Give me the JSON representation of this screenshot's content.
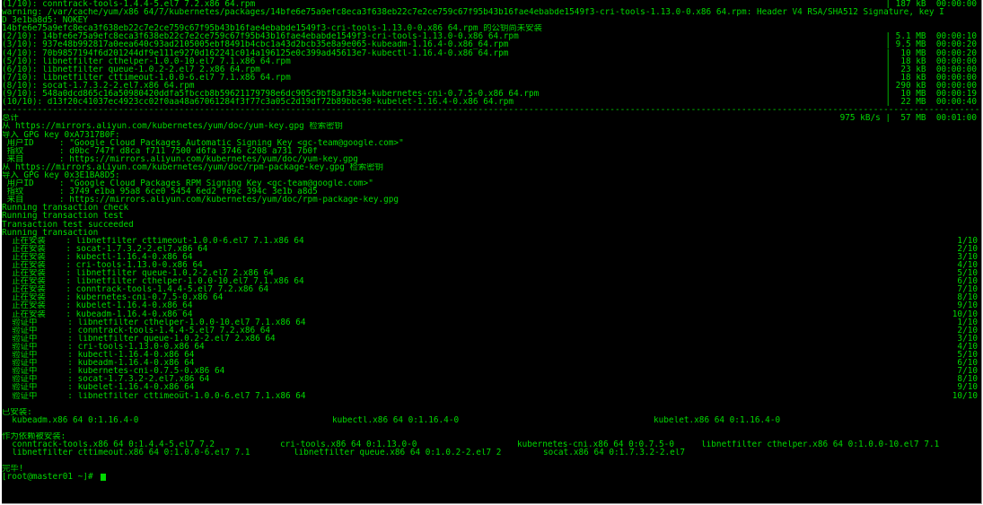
{
  "terminal": {
    "lines": [
      {
        "left": "(1/10): conntrack-tools-1.4.4-5.el7_7.2.x86_64.rpm",
        "mid": "| 187 kB  00:00:00"
      },
      {
        "left": "warning: /var/cache/yum/x86_64/7/kubernetes/packages/14bfe6e75a9efc8eca3f638eb22c7e2ce759c67f95b43b16fae4ebabde1549f3-cri-tools-1.13.0-0.x86_64.rpm: Header V4 RSA/SHA512 Signature, key I"
      },
      {
        "left": "D 3e1ba8d5: NOKEY"
      },
      {
        "left": "14bfe6e75a9efc8eca3f638eb22c7e2ce759c67f95b43b16fae4ebabde1549f3-cri-tools-1.13.0-0.x86_64.rpm 的公钥尚未安装"
      },
      {
        "left": "(2/10): 14bfe6e75a9efc8eca3f638eb22c7e2ce759c67f95b43b16fae4ebabde1549f3-cri-tools-1.13.0-0.x86_64.rpm",
        "mid": "| 5.1 MB  00:00:10"
      },
      {
        "left": "(3/10): 937e48b992817a0eea640c93ad2105005ebf8491b4cbc1a43d2bcb35e8a9e065-kubeadm-1.16.4-0.x86_64.rpm",
        "mid": "| 9.5 MB  00:00:20"
      },
      {
        "left": "(4/10): 70b9857194f6d201244df9e111e9270d162241c014a196125e0c399ad45613e7-kubectl-1.16.4-0.x86_64.rpm",
        "mid": "|  10 MB  00:00:20"
      },
      {
        "left": "(5/10): libnetfilter_cthelper-1.0.0-10.el7_7.1.x86_64.rpm",
        "mid": "|  18 kB  00:00:00"
      },
      {
        "left": "(6/10): libnetfilter_queue-1.0.2-2.el7_2.x86_64.rpm",
        "mid": "|  23 kB  00:00:00"
      },
      {
        "left": "(7/10): libnetfilter_cttimeout-1.0.0-6.el7_7.1.x86_64.rpm",
        "mid": "|  18 kB  00:00:00"
      },
      {
        "left": "(8/10): socat-1.7.3.2-2.el7.x86_64.rpm",
        "mid": "| 290 kB  00:00:00"
      },
      {
        "left": "(9/10): 548a0dcd865c16a50980420ddfa5fbccb8b59621179798e6dc905c9bf8af3b34-kubernetes-cni-0.7.5-0.x86_64.rpm",
        "mid": "|  10 MB  00:00:19"
      },
      {
        "left": "(10/10): d13f20c41037ec4923cc02f0aa48a67061284f3f77c3a05c2d19df72b89bbc98-kubelet-1.16.4-0.x86_64.rpm",
        "mid": "|  22 MB  00:00:40"
      },
      {
        "left": "-------------------------------------------------------------------------------------------------------------------------------------------------------------------------------------------------------------------"
      },
      {
        "left": "总计",
        "mid": "975 kB/s |  57 MB  00:01:00"
      },
      {
        "left": "从 https://mirrors.aliyun.com/kubernetes/yum/doc/yum-key.gpg 检索密钥"
      },
      {
        "left": "导入 GPG key 0xA7317B0F:"
      },
      {
        "left": " 用户ID     : \"Google Cloud Packages Automatic Signing Key <gc-team@google.com>\""
      },
      {
        "left": " 指纹       : d0bc 747f d8ca f711 7500 d6fa 3746 c208 a731 7b0f"
      },
      {
        "left": " 来自       : https://mirrors.aliyun.com/kubernetes/yum/doc/yum-key.gpg"
      },
      {
        "left": "从 https://mirrors.aliyun.com/kubernetes/yum/doc/rpm-package-key.gpg 检索密钥"
      },
      {
        "left": "导入 GPG key 0x3E1BA8D5:"
      },
      {
        "left": " 用户ID     : \"Google Cloud Packages RPM Signing Key <gc-team@google.com>\""
      },
      {
        "left": " 指纹       : 3749 e1ba 95a8 6ce0 5454 6ed2 f09c 394c 3e1b a8d5"
      },
      {
        "left": " 来自       : https://mirrors.aliyun.com/kubernetes/yum/doc/rpm-package-key.gpg"
      },
      {
        "left": "Running transaction check"
      },
      {
        "left": "Running transaction test"
      },
      {
        "left": "Transaction test succeeded"
      },
      {
        "left": "Running transaction"
      },
      {
        "left": "  正在安装    : libnetfilter_cttimeout-1.0.0-6.el7_7.1.x86_64",
        "right": "1/10"
      },
      {
        "left": "  正在安装    : socat-1.7.3.2-2.el7.x86_64",
        "right": "2/10"
      },
      {
        "left": "  正在安装    : kubectl-1.16.4-0.x86_64",
        "right": "3/10"
      },
      {
        "left": "  正在安装    : cri-tools-1.13.0-0.x86_64",
        "right": "4/10"
      },
      {
        "left": "  正在安装    : libnetfilter_queue-1.0.2-2.el7_2.x86_64",
        "right": "5/10"
      },
      {
        "left": "  正在安装    : libnetfilter_cthelper-1.0.0-10.el7_7.1.x86_64",
        "right": "6/10"
      },
      {
        "left": "  正在安装    : conntrack-tools-1.4.4-5.el7_7.2.x86_64",
        "right": "7/10"
      },
      {
        "left": "  正在安装    : kubernetes-cni-0.7.5-0.x86_64",
        "right": "8/10"
      },
      {
        "left": "  正在安装    : kubelet-1.16.4-0.x86_64",
        "right": "9/10"
      },
      {
        "left": "  正在安装    : kubeadm-1.16.4-0.x86_64",
        "right": "10/10"
      },
      {
        "left": "  验证中      : libnetfilter_cthelper-1.0.0-10.el7_7.1.x86_64",
        "right": "1/10"
      },
      {
        "left": "  验证中      : conntrack-tools-1.4.4-5.el7_7.2.x86_64",
        "right": "2/10"
      },
      {
        "left": "  验证中      : libnetfilter_queue-1.0.2-2.el7_2.x86_64",
        "right": "3/10"
      },
      {
        "left": "  验证中      : cri-tools-1.13.0-0.x86_64",
        "right": "4/10"
      },
      {
        "left": "  验证中      : kubectl-1.16.4-0.x86_64",
        "right": "5/10"
      },
      {
        "left": "  验证中      : kubeadm-1.16.4-0.x86_64",
        "right": "6/10"
      },
      {
        "left": "  验证中      : kubernetes-cni-0.7.5-0.x86_64",
        "right": "7/10"
      },
      {
        "left": "  验证中      : socat-1.7.3.2-2.el7.x86_64",
        "right": "8/10"
      },
      {
        "left": "  验证中      : kubelet-1.16.4-0.x86_64",
        "right": "9/10"
      },
      {
        "left": "  验证中      : libnetfilter_cttimeout-1.0.0-6.el7_7.1.x86_64",
        "right": "10/10"
      },
      {
        "left": ""
      },
      {
        "left": "已安装:"
      },
      {
        "left": "  kubeadm.x86_64 0:1.16.4-0",
        "c2": "kubectl.x86_64 0:1.16.4-0",
        "c3": "kubelet.x86_64 0:1.16.4-0"
      },
      {
        "left": ""
      },
      {
        "left": "作为依赖被安装:"
      },
      {
        "left": "  conntrack-tools.x86_64 0:1.4.4-5.el7_7.2",
        "c2": "cri-tools.x86_64 0:1.13.0-0",
        "c3": "kubernetes-cni.x86_64 0:0.7.5-0",
        "c4": "libnetfilter_cthelper.x86_64 0:1.0.0-10.el7_7.1"
      },
      {
        "left": "  libnetfilter_cttimeout.x86_64 0:1.0.0-6.el7_7.1",
        "c2": "libnetfilter_queue.x86_64 0:1.0.2-2.el7_2",
        "c3": "socat.x86_64 0:1.7.3.2-2.el7"
      },
      {
        "left": ""
      },
      {
        "left": "完毕!"
      },
      {
        "left": "[root@master01 ~]# ",
        "cursor": true
      }
    ]
  },
  "colors": {
    "background": "#000000",
    "foreground": "#00d800"
  }
}
